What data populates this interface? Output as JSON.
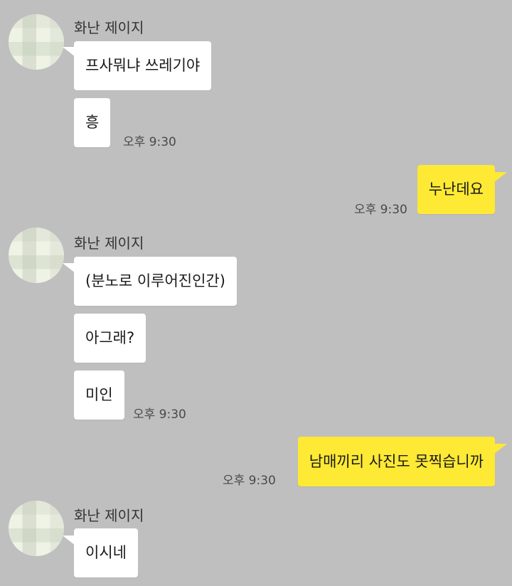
{
  "chat": {
    "sender_name": "화난 제이지",
    "group1": {
      "messages": [
        "프사뭐냐 쓰레기야",
        "흥"
      ],
      "time": "오후 9:30"
    },
    "out1": {
      "message": "누난데요",
      "time": "오후 9:30"
    },
    "group2": {
      "messages": [
        "(분노로 이루어진인간)",
        "아그래?",
        "미인"
      ],
      "time": "오후 9:30"
    },
    "out2": {
      "message": "남매끼리 사진도 못찍습니까",
      "time": "오후 9:30"
    },
    "group3": {
      "messages": [
        "이시네"
      ]
    }
  },
  "colors": {
    "background": "#bfbfbf",
    "incoming_bubble": "#ffffff",
    "outgoing_bubble": "#fee934"
  }
}
